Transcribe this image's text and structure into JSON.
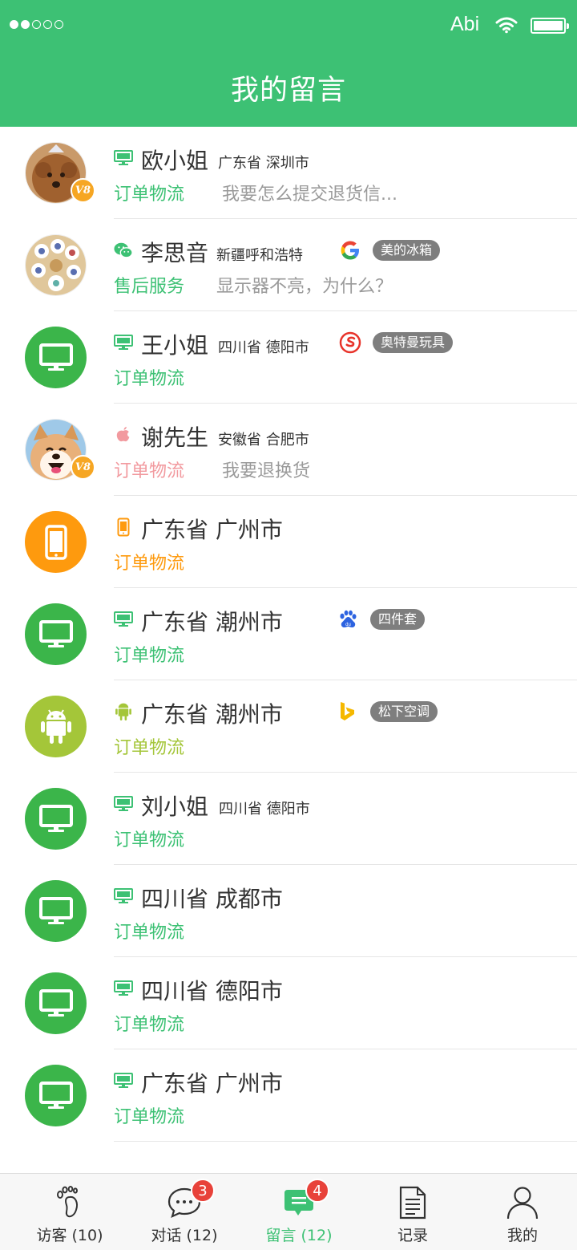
{
  "status": {
    "carrier": "Abi"
  },
  "header": {
    "title": "我的留言"
  },
  "colors": {
    "brand": "#3dc174",
    "orange": "#fe9a0e",
    "android": "#a4c639",
    "apple": "#f29a9f",
    "tab_active": "#3dc174"
  },
  "messages": [
    {
      "name": "欧小姐",
      "location": "广东省 深圳市",
      "device": "desktop-icon",
      "category": "订单物流",
      "message": "我要怎么提交退货信...",
      "avatar": "photo-dog",
      "vip": "V8"
    },
    {
      "name": "李思音",
      "location": "新疆呼和浩特",
      "device": "wechat-icon",
      "source": "google-icon",
      "tag": "美的冰箱",
      "category": "售后服务",
      "message": "显示器不亮，为什么？",
      "avatar": "photo-figures"
    },
    {
      "name": "王小姐",
      "location": "四川省 德阳市",
      "device": "desktop-icon",
      "source": "sogou-icon",
      "tag": "奥特曼玩具",
      "category": "订单物流",
      "avatar": "desktop-avatar"
    },
    {
      "name": "谢先生",
      "location": "安徽省 合肥市",
      "device": "apple-icon",
      "category": "订单物流",
      "message": "我要退换货",
      "avatar": "photo-shiba",
      "vip": "V8"
    },
    {
      "name": "广东省 广州市",
      "device": "mobile-icon",
      "category": "订单物流",
      "avatar": "mobile-avatar"
    },
    {
      "name": "广东省 潮州市",
      "device": "desktop-icon",
      "source": "baidu-icon",
      "tag": "四件套",
      "category": "订单物流",
      "avatar": "desktop-avatar"
    },
    {
      "name": "广东省 潮州市",
      "device": "android-icon",
      "source": "bing-icon",
      "tag": "松下空调",
      "category": "订单物流",
      "avatar": "android-avatar"
    },
    {
      "name": "刘小姐",
      "location": "四川省 德阳市",
      "device": "desktop-icon",
      "category": "订单物流",
      "avatar": "desktop-avatar"
    },
    {
      "name": "四川省 成都市",
      "device": "desktop-icon",
      "category": "订单物流",
      "avatar": "desktop-avatar"
    },
    {
      "name": "四川省 德阳市",
      "device": "desktop-icon",
      "category": "订单物流",
      "avatar": "desktop-avatar"
    },
    {
      "name": "广东省 广州市",
      "device": "desktop-icon",
      "category": "订单物流",
      "avatar": "desktop-avatar"
    }
  ],
  "tabbar": {
    "visitors": {
      "label": "访客 (10)"
    },
    "chats": {
      "label": "对话 (12)",
      "badge": "3"
    },
    "messages": {
      "label": "留言 (12)",
      "badge": "4"
    },
    "records": {
      "label": "记录"
    },
    "mine": {
      "label": "我的"
    }
  }
}
